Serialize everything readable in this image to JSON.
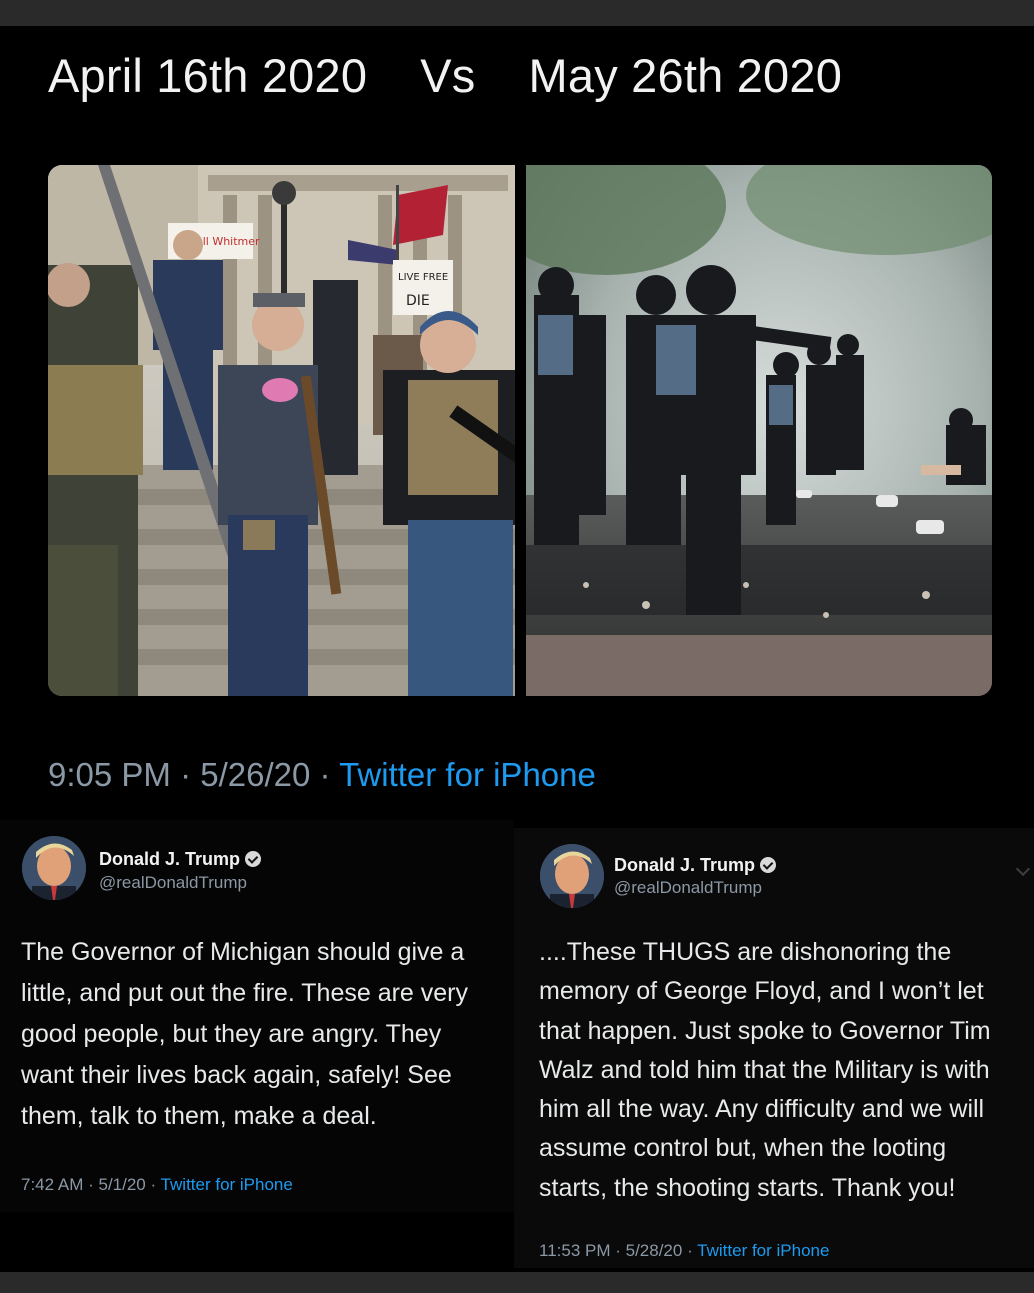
{
  "headline": {
    "left": "April 16th 2020",
    "vs": "Vs",
    "right": "May 26th 2020"
  },
  "main_tweet_meta": {
    "time": "9:05 PM",
    "date": "5/26/20",
    "source": "Twitter for iPhone"
  },
  "photos": {
    "left_sign_recall": "Recall Whitmer",
    "left_sign_live_free": "LIVE FREE or DIE"
  },
  "tweet_left": {
    "name": "Donald J. Trump",
    "handle": "@realDonaldTrump",
    "lines": [
      "The Governor of Michigan should give a",
      "little, and put out the fire. These are very",
      "good people, but they are angry. They",
      "want their lives back again, safely! See",
      "them, talk to them, make a deal."
    ],
    "time": "7:42 AM",
    "date": "5/1/20",
    "source": "Twitter for iPhone"
  },
  "tweet_right": {
    "name": "Donald J. Trump",
    "handle": "@realDonaldTrump",
    "lines": [
      "....These THUGS are dishonoring the",
      "memory of George Floyd, and I won’t let",
      "that happen. Just spoke to Governor Tim",
      "Walz and told him that the Military is with",
      "him all the way. Any difficulty and we will",
      "assume control but, when the looting",
      "starts, the shooting starts. Thank you!"
    ],
    "time": "11:53 PM",
    "date": "5/28/20",
    "source": "Twitter for iPhone"
  },
  "icons": {
    "verified": "verified-badge-icon",
    "menu": "chevron-down-icon"
  }
}
